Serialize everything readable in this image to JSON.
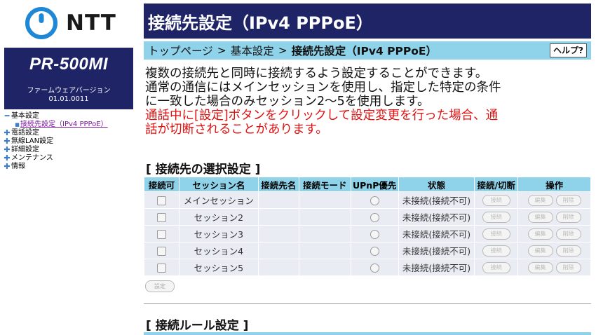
{
  "sidebar": {
    "logo_text": "NTT",
    "model": "PR-500MI",
    "firmware_label": "ファームウェアバージョン",
    "firmware_version": "01.01.0011",
    "nav": [
      {
        "mark": "━",
        "label": "基本設定"
      },
      {
        "mark": "■",
        "label": "接続先設定（IPv4 PPPoE）",
        "sub": true
      },
      {
        "mark": "✚",
        "label": "電話設定"
      },
      {
        "mark": "✚",
        "label": "無線LAN設定"
      },
      {
        "mark": "✚",
        "label": "詳細設定"
      },
      {
        "mark": "✚",
        "label": "メンテナンス"
      },
      {
        "mark": "✚",
        "label": "情報"
      }
    ]
  },
  "header": {
    "title": "接続先設定（IPv4 PPPoE）",
    "breadcrumb": [
      "トップページ",
      "基本設定",
      "接続先設定（IPv4 PPPoE）"
    ],
    "breadcrumb_sep": ">",
    "help_label": "ヘルプ?"
  },
  "description": {
    "line1": "複数の接続先と同時に接続するよう設定することができます。",
    "line2": "通常の通信にはメインセッションを使用し、指定した特定の条件",
    "line3": "に一致した場合のみセッション2〜5を使用します。",
    "warn1": "通話中に[設定]ボタンをクリックして設定変更を行った場合、通",
    "warn2": "話が切断されることがあります。"
  },
  "colors": {
    "accent_navy": "#1e2466",
    "accent_cyan": "#8fd3ea",
    "warning": "#e01010"
  },
  "sessions_section": {
    "title": "[ 接続先の選択設定 ]",
    "columns": [
      "接続可",
      "セッション名",
      "接続先名",
      "接続モード",
      "UPnP優先",
      "状態",
      "接続/切断",
      "操作"
    ],
    "rows": [
      {
        "name": "メインセッション",
        "status": "未接続(接続不可)",
        "connect_label": "接続",
        "edit_label": "編集",
        "delete_label": "削除"
      },
      {
        "name": "セッション2",
        "status": "未接続(接続不可)",
        "connect_label": "接続",
        "edit_label": "編集",
        "delete_label": "削除"
      },
      {
        "name": "セッション3",
        "status": "未接続(接続不可)",
        "connect_label": "接続",
        "edit_label": "編集",
        "delete_label": "削除"
      },
      {
        "name": "セッション4",
        "status": "未接続(接続不可)",
        "connect_label": "接続",
        "edit_label": "編集",
        "delete_label": "削除"
      },
      {
        "name": "セッション5",
        "status": "未接続(接続不可)",
        "connect_label": "接続",
        "edit_label": "編集",
        "delete_label": "削除"
      }
    ],
    "set_button": "設定"
  },
  "rules_section": {
    "title": "[ 接続ルール設定 ]"
  }
}
